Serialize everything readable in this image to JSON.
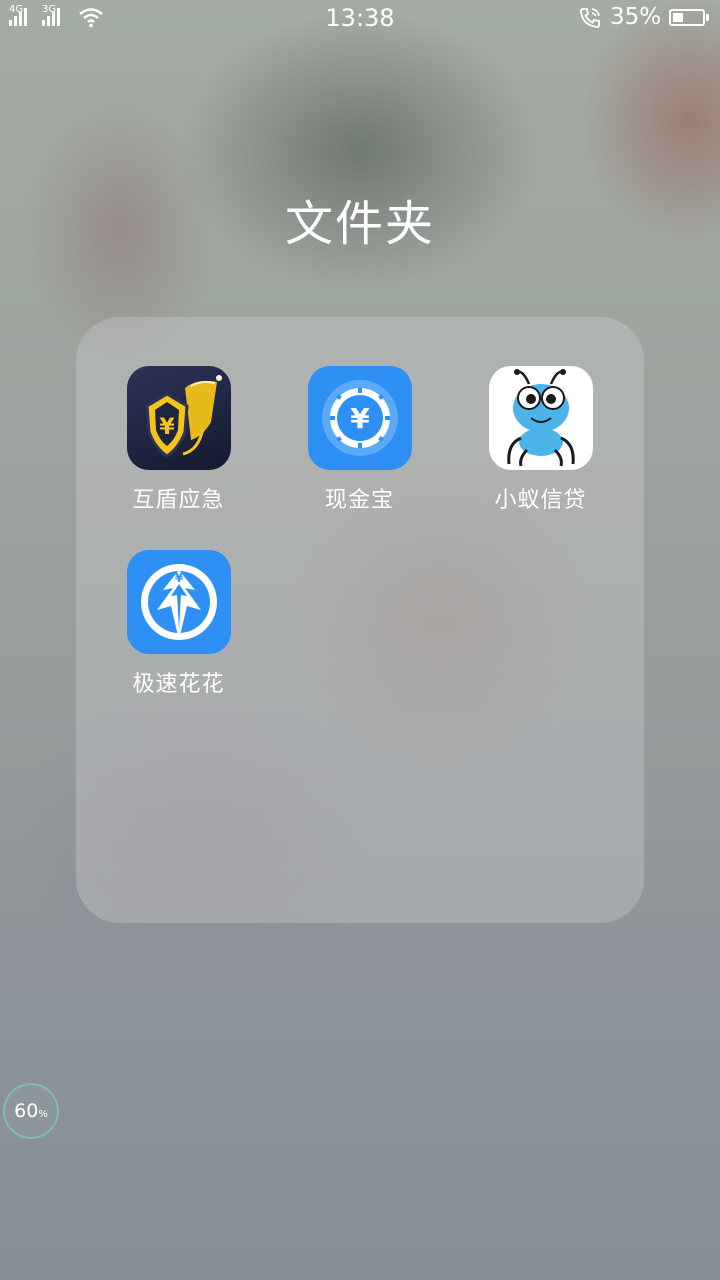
{
  "status_bar": {
    "network_1": "4G",
    "network_2": "3G",
    "time": "13:38",
    "battery_percent": "35%",
    "battery_level": 0.35,
    "icons": [
      "signal-icon",
      "signal-icon",
      "wifi-icon",
      "call-icon",
      "battery-icon"
    ]
  },
  "folder": {
    "title": "文件夹",
    "apps": [
      {
        "label": "互盾应急",
        "icon": "shield-yen-icon"
      },
      {
        "label": "现金宝",
        "icon": "yen-coin-icon"
      },
      {
        "label": "小蚁信贷",
        "icon": "ant-mascot-icon"
      },
      {
        "label": "极速花花",
        "icon": "arrow-yen-icon"
      }
    ]
  },
  "floating_badge": {
    "value": "60",
    "unit": "%"
  },
  "colors": {
    "blue_app": "#2e8ff5",
    "dark_navy": "#1d2440",
    "gold": "#f5c518"
  }
}
